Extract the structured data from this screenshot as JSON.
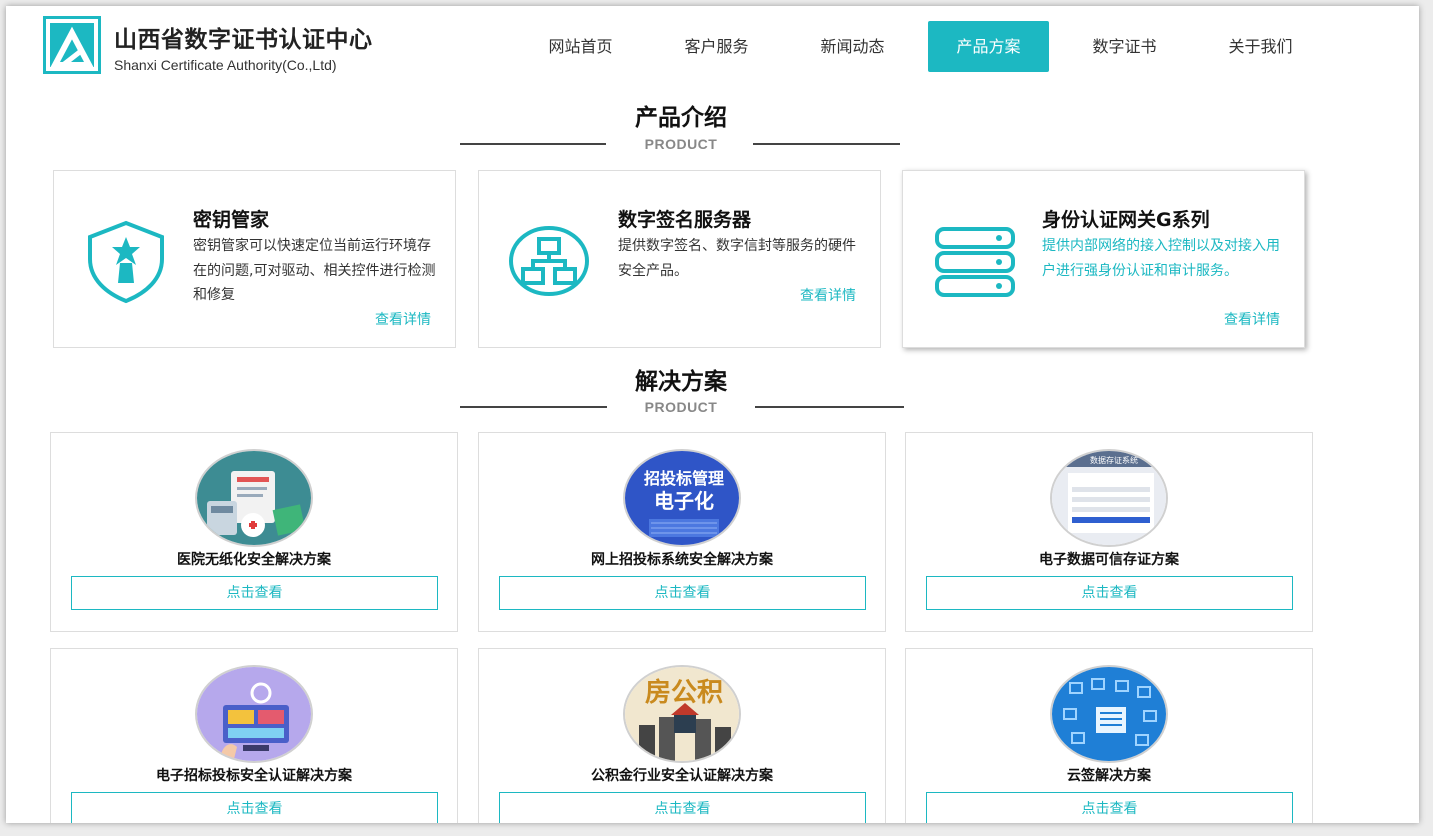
{
  "brand": {
    "name_cn": "山西省数字证书认证中心",
    "name_en": "Shanxi Certificate Authority(Co.,Ltd)"
  },
  "nav": [
    {
      "label": "网站首页",
      "active": false
    },
    {
      "label": "客户服务",
      "active": false
    },
    {
      "label": "新闻动态",
      "active": false
    },
    {
      "label": "产品方案",
      "active": true
    },
    {
      "label": "数字证书",
      "active": false
    },
    {
      "label": "关于我们",
      "active": false
    }
  ],
  "products_section": {
    "title": "产品介绍",
    "subtitle": "PRODUCT",
    "items": [
      {
        "icon": "shield-icon",
        "title": "密钥管家",
        "desc": "密钥管家可以快速定位当前运行环境存在的问题,可对驱动、相关控件进行检测和修复",
        "link": "查看详情"
      },
      {
        "icon": "network-server-icon",
        "title": "数字签名服务器",
        "desc": "提供数字签名、数字信封等服务的硬件安全产品。",
        "link": "查看详情"
      },
      {
        "icon": "server-rack-icon",
        "title": "身份认证网关G系列",
        "desc": "提供内部网络的接入控制以及对接入用户进行强身份认证和审计服务。",
        "link": "查看详情"
      }
    ]
  },
  "solutions_section": {
    "title": "解决方案",
    "subtitle": "PRODUCT",
    "button_label": "点击查看",
    "items": [
      {
        "title": "医院无纸化安全解决方案"
      },
      {
        "title": "网上招投标系统安全解决方案",
        "image_text": [
          "招投标管理",
          "电子化"
        ]
      },
      {
        "title": "电子数据可信存证方案",
        "image_text": [
          "数据存证系统"
        ]
      },
      {
        "title": "电子招标投标安全认证解决方案"
      },
      {
        "title": "公积金行业安全认证解决方案",
        "image_text": [
          "房公积"
        ]
      },
      {
        "title": "云签解决方案"
      }
    ]
  },
  "colors": {
    "accent": "#1cb8c2",
    "text": "#222222",
    "subtle": "#888888"
  }
}
